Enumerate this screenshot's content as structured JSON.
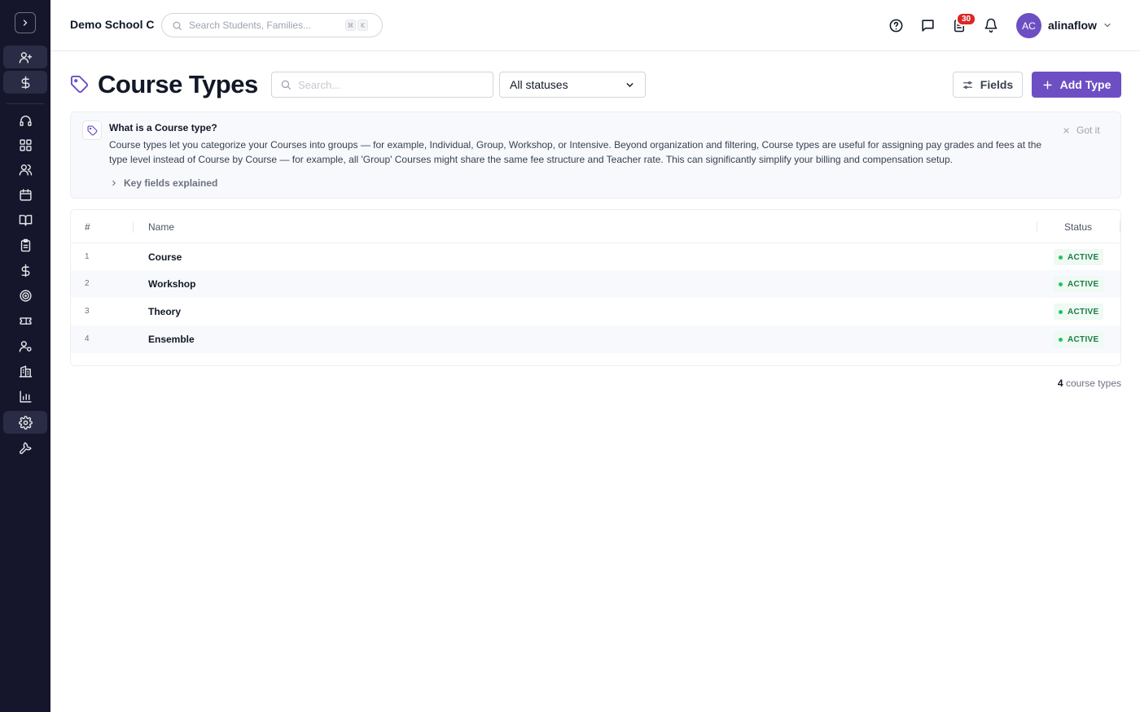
{
  "topbar": {
    "school_name": "Demo School C",
    "search_placeholder": "Search Students, Families...",
    "kbd_1": "⌘",
    "kbd_2": "K",
    "notification_count": "30",
    "user": {
      "initials": "AC",
      "name": "alinaflow"
    }
  },
  "page": {
    "title": "Course Types",
    "search_placeholder": "Search...",
    "status_filter": "All statuses",
    "fields_label": "Fields",
    "add_label": "Add Type"
  },
  "info": {
    "title": "What is a Course type?",
    "body": "Course types let you categorize your Courses into groups — for example, Individual, Group, Workshop, or Intensive. Beyond organization and filtering, Course types are useful for assigning pay grades and fees at the type level instead of Course by Course — for example, all 'Group' Courses might share the same fee structure and Teacher rate. This can significantly simplify your billing and compensation setup.",
    "dismiss_label": "Got it",
    "key_fields_label": "Key fields explained"
  },
  "table": {
    "columns": {
      "num": "#",
      "name": "Name",
      "status": "Status"
    },
    "rows": [
      {
        "num": "1",
        "name": "Course",
        "status": "ACTIVE"
      },
      {
        "num": "2",
        "name": "Workshop",
        "status": "ACTIVE"
      },
      {
        "num": "3",
        "name": "Theory",
        "status": "ACTIVE"
      },
      {
        "num": "4",
        "name": "Ensemble",
        "status": "ACTIVE"
      }
    ]
  },
  "footer": {
    "count": "4",
    "count_label": "course types"
  },
  "colors": {
    "sidebar_bg": "#15162b",
    "accent": "#6d4fc3",
    "active_status": "#1f7a47"
  }
}
